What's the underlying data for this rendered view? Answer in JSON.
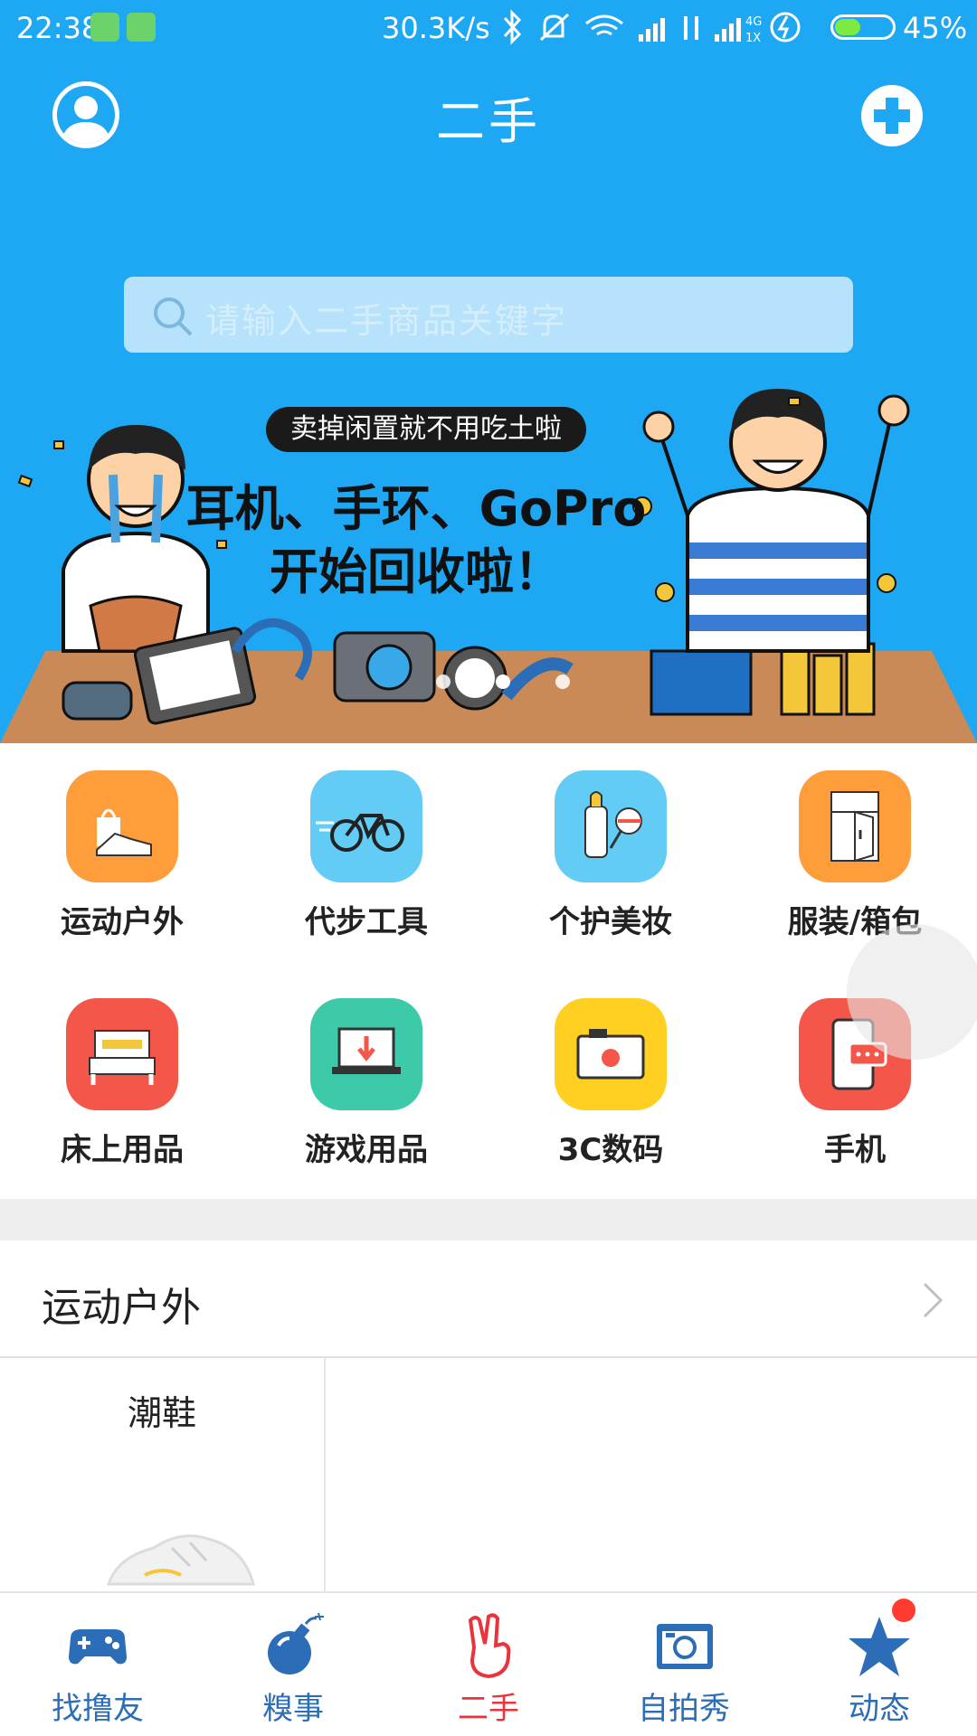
{
  "status_bar": {
    "time": "22:38",
    "speed": "30.3K/s",
    "battery_pct": "45%",
    "battery_level": 0.45
  },
  "header": {
    "title": "二手",
    "search_placeholder": "请输入二手商品关键字"
  },
  "banner": {
    "tag": "卖掉闲置就不用吃土啦",
    "line1": "耳机、手环、GoPro",
    "line2": "开始回收啦！",
    "page_count": 3,
    "active_page": 1
  },
  "categories": [
    {
      "label": "运动户外",
      "icon": "shopping-bag-shoe-icon",
      "color": "#ff9d3b"
    },
    {
      "label": "代步工具",
      "icon": "bicycle-icon",
      "color": "#63ccf5"
    },
    {
      "label": "个护美妆",
      "icon": "cosmetics-icon",
      "color": "#63ccf5"
    },
    {
      "label": "服装/箱包",
      "icon": "wardrobe-icon",
      "color": "#ff9d3b"
    },
    {
      "label": "床上用品",
      "icon": "bed-icon",
      "color": "#f4574a"
    },
    {
      "label": "游戏用品",
      "icon": "laptop-download-icon",
      "color": "#3ccaa8"
    },
    {
      "label": "3C数码",
      "icon": "camera-icon",
      "color": "#ffcf21"
    },
    {
      "label": "手机",
      "icon": "mobile-phone-icon",
      "color": "#f4574a"
    }
  ],
  "section": {
    "title": "运动户外",
    "sub_title": "潮鞋"
  },
  "nav": [
    {
      "label": "找撸友",
      "icon": "gamepad-icon",
      "active": false
    },
    {
      "label": "糗事",
      "icon": "bomb-icon",
      "active": false
    },
    {
      "label": "二手",
      "icon": "victory-hand-icon",
      "active": true
    },
    {
      "label": "自拍秀",
      "icon": "camera-icon",
      "active": false
    },
    {
      "label": "动态",
      "icon": "star-icon",
      "active": false,
      "badge": true
    }
  ],
  "colors": {
    "brand_blue": "#1ea7f3",
    "nav_blue": "#2b6db6",
    "nav_active": "#e8343c",
    "banner_table": "#c98a57"
  }
}
